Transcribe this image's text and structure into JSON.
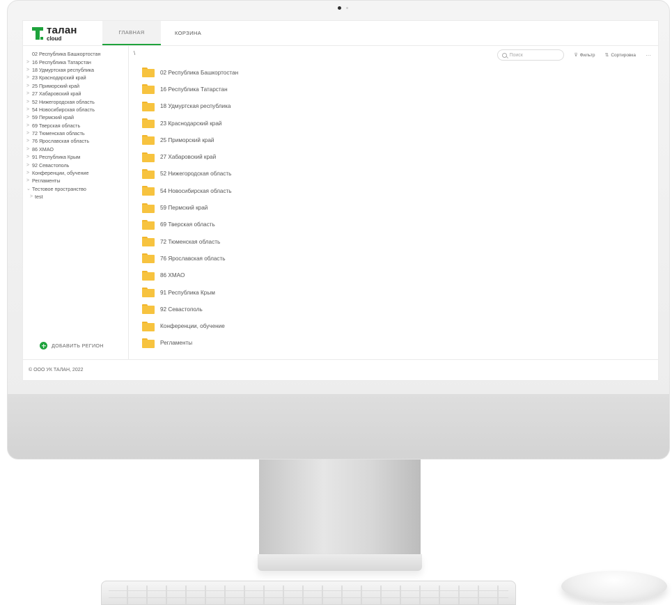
{
  "header": {
    "logo": {
      "name": "талан",
      "sub": "cloud"
    },
    "tabs": [
      {
        "label": "ГЛАВНАЯ",
        "active": true
      },
      {
        "label": "КОРЗИНА",
        "active": false
      }
    ]
  },
  "sidebar": {
    "items": [
      {
        "label": "02 Республика Башкортостан",
        "chevron": ""
      },
      {
        "label": "16 Республика Татарстан",
        "chevron": ">"
      },
      {
        "label": "18 Удмуртская республика",
        "chevron": ">"
      },
      {
        "label": "23 Краснодарский край",
        "chevron": ">"
      },
      {
        "label": "25 Приморский край",
        "chevron": ">"
      },
      {
        "label": "27 Хабаровский край",
        "chevron": ">"
      },
      {
        "label": "52 Нижегородская область",
        "chevron": ">"
      },
      {
        "label": "54 Новосибирская область",
        "chevron": ">"
      },
      {
        "label": "59 Пермский край",
        "chevron": ">"
      },
      {
        "label": "69 Тверская область",
        "chevron": ">"
      },
      {
        "label": "72 Тюменская область",
        "chevron": ">"
      },
      {
        "label": "76 Ярославская область",
        "chevron": ">"
      },
      {
        "label": "86 ХМАО",
        "chevron": ">"
      },
      {
        "label": "91 Республика Крым",
        "chevron": ">"
      },
      {
        "label": "92 Севастополь",
        "chevron": ">"
      },
      {
        "label": "Конференции, обучение",
        "chevron": ">"
      },
      {
        "label": "Регламенты",
        "chevron": ">"
      },
      {
        "label": "Тестовое пространство",
        "chevron": "⌄"
      },
      {
        "label": "test",
        "chevron": ">"
      }
    ],
    "add_region_label": "ДОБАВИТЬ РЕГИОН"
  },
  "main": {
    "path": "\\",
    "search_placeholder": "Поиск",
    "filter_label": "Фильтр",
    "sort_label": "Сортировка",
    "more_label": "···",
    "folders": [
      "02 Республика Башкортостан",
      "16 Республика Татарстан",
      "18 Удмуртская республика",
      "23 Краснодарский край",
      "25 Приморский край",
      "27 Хабаровский край",
      "52 Нижегородская область",
      "54 Новосибирская область",
      "59 Пермский край",
      "69 Тверская область",
      "72 Тюменская область",
      "76 Ярославская область",
      "86 ХМАО",
      "91 Республика Крым",
      "92 Севастополь",
      "Конференции, обучение",
      "Регламенты"
    ]
  },
  "footer": {
    "copyright": "© ООО УК ТАЛАН, 2022"
  },
  "colors": {
    "accent": "#1ea33c",
    "folder": "#f7c33f"
  }
}
